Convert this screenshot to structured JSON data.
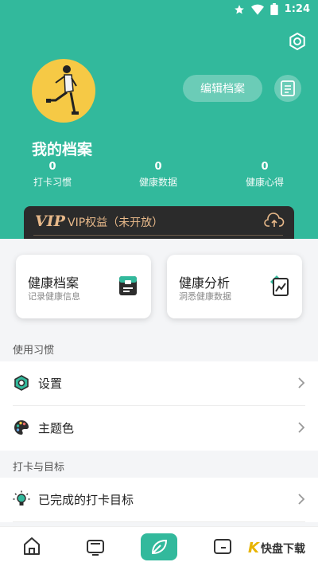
{
  "status_bar": {
    "time": "1:24"
  },
  "profile": {
    "edit_button": "编辑档案",
    "title": "我的档案",
    "stats": [
      {
        "value": "0",
        "label": "打卡习惯"
      },
      {
        "value": "0",
        "label": "健康数据"
      },
      {
        "value": "0",
        "label": "健康心得"
      }
    ]
  },
  "vip": {
    "logo": "VIP",
    "text": "VIP权益（未开放）"
  },
  "cards": [
    {
      "title": "健康档案",
      "subtitle": "记录健康信息"
    },
    {
      "title": "健康分析",
      "subtitle": "洞悉健康数据"
    }
  ],
  "sections": [
    {
      "label": "使用习惯",
      "items": [
        {
          "label": "设置",
          "icon": "gear-icon"
        },
        {
          "label": "主题色",
          "icon": "palette-icon"
        }
      ]
    },
    {
      "label": "打卡与目标",
      "items": [
        {
          "label": "已完成的打卡目标",
          "icon": "lightbulb-icon"
        }
      ]
    }
  ],
  "watermark": {
    "text": "快盘下载"
  },
  "colors": {
    "accent": "#32b99c",
    "vip_bg": "#2b2b2b",
    "vip_gold": "#e8b98a",
    "avatar_bg": "#f6c945"
  }
}
